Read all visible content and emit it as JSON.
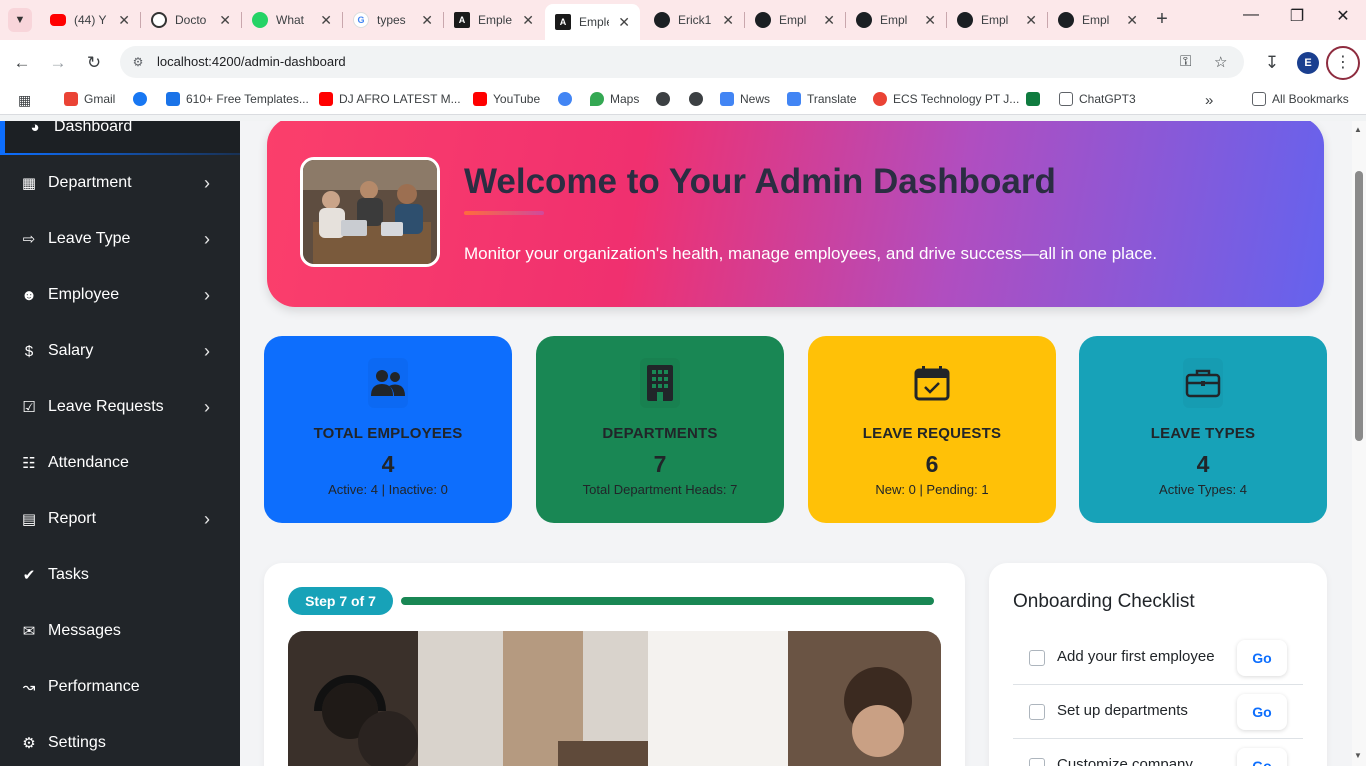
{
  "browser": {
    "tabs": [
      {
        "title": "(44) Y",
        "icon": "youtube-icon"
      },
      {
        "title": "Docto",
        "icon": "chatgpt-icon"
      },
      {
        "title": "What",
        "icon": "whatsapp-icon"
      },
      {
        "title": "types",
        "icon": "google-icon"
      },
      {
        "title": "Emple",
        "icon": "angular-icon"
      },
      {
        "title": "Emple",
        "icon": "angular-icon",
        "active": true
      },
      {
        "title": "Erick1",
        "icon": "github-icon"
      },
      {
        "title": "Empl",
        "icon": "github-icon"
      },
      {
        "title": "Empl",
        "icon": "github-icon"
      },
      {
        "title": "Empl",
        "icon": "github-icon"
      },
      {
        "title": "Empl",
        "icon": "github-icon"
      }
    ],
    "url": "localhost:4200/admin-dashboard",
    "profile_initial": "E",
    "bookmarks": [
      {
        "label": "Gmail",
        "color": "#ea4335"
      },
      {
        "label": "",
        "color": "#1877f2"
      },
      {
        "label": "610+ Free Templates...",
        "color": "#1a73e8"
      },
      {
        "label": "DJ AFRO LATEST M...",
        "color": "#ff0000"
      },
      {
        "label": "YouTube",
        "color": "#ff0000"
      },
      {
        "label": "",
        "color": "#4285f4"
      },
      {
        "label": "Maps",
        "color": "#34a853"
      },
      {
        "label": "",
        "color": "#3c4043"
      },
      {
        "label": "",
        "color": "#3c4043"
      },
      {
        "label": "News",
        "color": "#4285f4"
      },
      {
        "label": "Translate",
        "color": "#4285f4"
      },
      {
        "label": "ECS Technology PT J...",
        "color": "#ea4335"
      },
      {
        "label": "",
        "color": "#0f7b3f"
      },
      {
        "label": "ChatGPT3",
        "color": "#5f6368"
      }
    ],
    "all_bookmarks": "All Bookmarks"
  },
  "sidebar": {
    "items": [
      {
        "label": "Dashboard",
        "icon": "dashboard-icon",
        "chevron": false,
        "active": true
      },
      {
        "label": "Department",
        "icon": "building-icon",
        "chevron": true
      },
      {
        "label": "Leave Type",
        "icon": "leave-type-icon",
        "chevron": true
      },
      {
        "label": "Employee",
        "icon": "user-circle-icon",
        "chevron": true
      },
      {
        "label": "Salary",
        "icon": "dollar-icon",
        "chevron": true
      },
      {
        "label": "Leave Requests",
        "icon": "calendar-check-icon",
        "chevron": true
      },
      {
        "label": "Attendance",
        "icon": "calendar-icon",
        "chevron": false
      },
      {
        "label": "Report",
        "icon": "report-icon",
        "chevron": true
      },
      {
        "label": "Tasks",
        "icon": "check-circle-icon",
        "chevron": false
      },
      {
        "label": "Messages",
        "icon": "chat-icon",
        "chevron": false
      },
      {
        "label": "Performance",
        "icon": "chart-line-icon",
        "chevron": false
      },
      {
        "label": "Settings",
        "icon": "gear-icon",
        "chevron": false
      }
    ]
  },
  "hero": {
    "title": "Welcome to Your Admin Dashboard",
    "subtitle": "Monitor your organization's health, manage employees, and drive success—all in one place."
  },
  "stats": [
    {
      "label": "TOTAL EMPLOYEES",
      "value": "4",
      "sub": "Active: 4 | Inactive: 0",
      "bg": "#0d6efd",
      "fg": "#212529",
      "icon": "users-icon"
    },
    {
      "label": "DEPARTMENTS",
      "value": "7",
      "sub": "Total Department Heads: 7",
      "bg": "#198754",
      "fg": "#212529",
      "icon": "building-icon"
    },
    {
      "label": "LEAVE REQUESTS",
      "value": "6",
      "sub": "New: 0 | Pending: 1",
      "bg": "#ffc107",
      "fg": "#212529",
      "icon": "calendar-check-icon"
    },
    {
      "label": "LEAVE TYPES",
      "value": "4",
      "sub": "Active Types: 4",
      "bg": "#17a2b8",
      "fg": "#212529",
      "icon": "briefcase-icon"
    }
  ],
  "wizard": {
    "step_label": "Step 7 of 7",
    "progress": 1.0
  },
  "checklist": {
    "title": "Onboarding Checklist",
    "go_label": "Go",
    "items": [
      {
        "label": "Add your first employee",
        "checked": false
      },
      {
        "label": "Set up departments",
        "checked": false
      },
      {
        "label": "Customize company",
        "checked": false
      }
    ]
  }
}
